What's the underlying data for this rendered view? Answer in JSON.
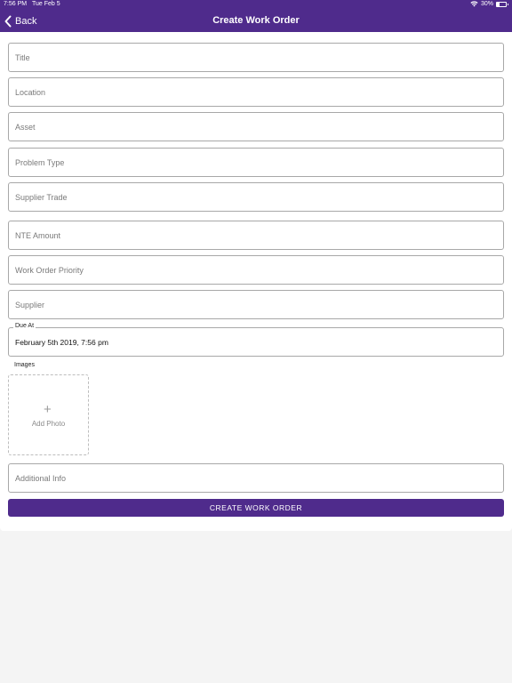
{
  "status_bar": {
    "time": "7:56 PM",
    "date": "Tue Feb 5",
    "battery": "30%"
  },
  "nav": {
    "back_label": "Back",
    "title": "Create Work Order"
  },
  "form": {
    "title_placeholder": "Title",
    "location_placeholder": "Location",
    "asset_placeholder": "Asset",
    "problem_type_placeholder": "Problem Type",
    "supplier_trade_placeholder": "Supplier Trade",
    "nte_amount_placeholder": "NTE Amount",
    "priority_placeholder": "Work Order Priority",
    "supplier_placeholder": "Supplier",
    "due_at_label": "Due At",
    "due_at_value": "February 5th 2019, 7:56 pm",
    "images_label": "Images",
    "add_photo_label": "Add Photo",
    "additional_info_placeholder": "Additional Info",
    "submit_label": "CREATE WORK ORDER"
  },
  "colors": {
    "brand": "#4f2b8c",
    "background": "#f4f4f4"
  }
}
